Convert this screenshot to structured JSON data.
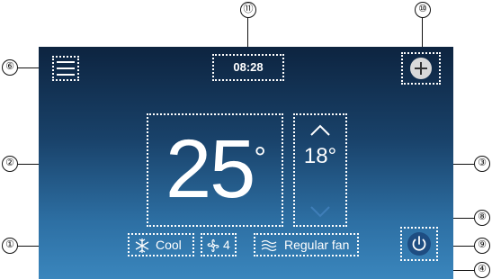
{
  "header": {
    "clock": "08:28"
  },
  "temperature": {
    "set_value": "25",
    "set_unit": "°",
    "outside_value": "18",
    "outside_unit": "°"
  },
  "status": {
    "mode_label": "Cool",
    "fan_speed": "4",
    "fan_mode_label": "Regular fan"
  },
  "callouts": [
    "①",
    "②",
    "③",
    "④",
    "⑥",
    "⑧",
    "⑨",
    "⑩",
    "⑪"
  ],
  "colors": {
    "screen_top": "#0d2440",
    "screen_bottom": "#3a86bd",
    "power_button": "#1e4d82"
  },
  "icons": [
    "menu-icon",
    "add-icon",
    "chevron-up-icon",
    "chevron-down-icon",
    "snowflake-icon",
    "fan-icon",
    "wind-icon",
    "power-icon"
  ]
}
